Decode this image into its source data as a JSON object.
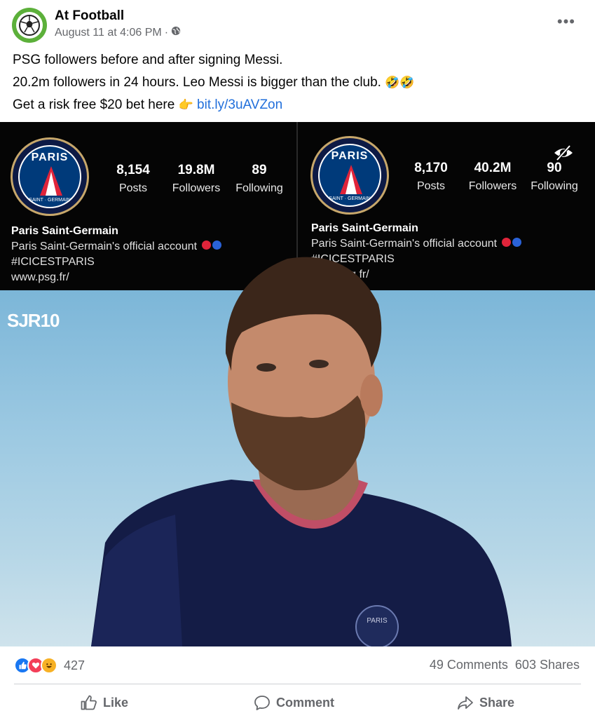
{
  "post": {
    "page_name": "At Football",
    "timestamp": "August 11 at 4:06 PM",
    "meta_separator": "·",
    "privacy_icon": "globe-icon",
    "more_icon": "more-horizontal-icon",
    "more_label": "•••",
    "text_line1": "PSG followers before and after signing Messi.",
    "text_line2": "20.2m followers in 24 hours. Leo Messi is bigger than the club.",
    "text_line2_emoji": "🤣🤣",
    "text_line3": "Get a risk free $20 bet here",
    "text_line3_emoji": "👉",
    "link_text": "bit.ly/3uAVZon"
  },
  "media": {
    "before": {
      "logo_text": "PARIS",
      "logo_subtext": "SAINT · GERMAIN",
      "posts_value": "8,154",
      "posts_label": "Posts",
      "followers_value": "19.8M",
      "followers_label": "Followers",
      "following_value": "89",
      "following_label": "Following",
      "bio_name": "Paris Saint-Germain",
      "bio_desc": "Paris Saint-Germain's official account",
      "bio_hashtag": "#ICICESTPARIS",
      "bio_url": "www.psg.fr/"
    },
    "after": {
      "logo_text": "PARIS",
      "logo_subtext": "SAINT · GERMAIN",
      "posts_value": "8,170",
      "posts_label": "Posts",
      "followers_value": "40.2M",
      "followers_label": "Followers",
      "following_value": "90",
      "following_label": "Following",
      "bio_name": "Paris Saint-Germain",
      "bio_desc": "Paris Saint-Germain's official account",
      "bio_hashtag": "#ICICESTPARIS",
      "bio_url": "www.psg.fr/",
      "hidden_icon": "eye-slash-icon"
    },
    "watermark": "SJR10",
    "jersey_crest_text": "PARIS"
  },
  "engagement": {
    "reaction_icons": [
      "like-reaction-icon",
      "love-reaction-icon",
      "haha-reaction-icon"
    ],
    "reaction_count": "427",
    "comments": "49 Comments",
    "shares": "603 Shares"
  },
  "actions": {
    "like_label": "Like",
    "comment_label": "Comment",
    "share_label": "Share"
  },
  "colors": {
    "link": "#216fdb",
    "secondary_text": "#65676b",
    "avatar_green": "#5cb03a",
    "psg_navy": "#003a7a",
    "psg_red": "#e0243a"
  }
}
